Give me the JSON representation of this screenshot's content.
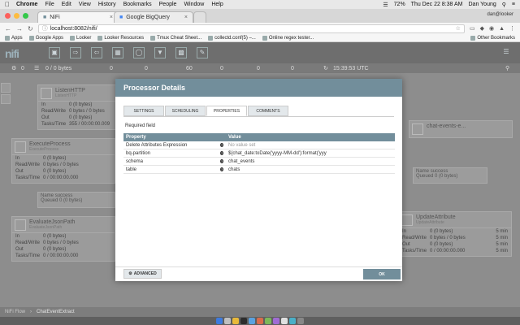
{
  "menubar": {
    "app": "Chrome",
    "items": [
      "File",
      "Edit",
      "View",
      "History",
      "Bookmarks",
      "People",
      "Window",
      "Help"
    ],
    "battery": "72%",
    "datetime": "Thu Dec 22  8:38 AM",
    "user": "Dan Young"
  },
  "browser": {
    "tabs": [
      {
        "label": "NiFi"
      },
      {
        "label": "Google BigQuery"
      }
    ],
    "profile": "dan@looker",
    "url": "localhost:8082/nifi/",
    "bookmarks": [
      "Apps",
      "Google Apps",
      "Looker",
      "Looker Resources",
      "Tmux Cheat Sheet...",
      "collectd.conf(5) –...",
      "Online regex tester..."
    ],
    "other_bookmarks": "Other Bookmarks"
  },
  "nifi": {
    "status": {
      "threads": "0",
      "queued": "0 / 0 bytes",
      "s1": "0",
      "s2": "0",
      "s3": "60",
      "s4": "0",
      "s5": "0",
      "s6": "0",
      "time": "15:39:53 UTC"
    },
    "processors": [
      {
        "name": "ListenHTTP",
        "type": "ListenHTTP",
        "in": "0 (0 bytes)",
        "rw": "0 bytes / 0 bytes",
        "out": "0 (0 bytes)",
        "tasks": "355 / 00:00:00.009"
      },
      {
        "name": "ExecuteProcess",
        "type": "ExecuteProcess",
        "in": "0 (0 bytes)",
        "rw": "0 bytes / 0 bytes",
        "out": "0 (0 bytes)",
        "tasks": "0 / 00:00:00.000"
      },
      {
        "name": "EvaluateJsonPath",
        "type": "EvaluateJsonPath",
        "in": "0 (0 bytes)",
        "rw": "0 bytes / 0 bytes",
        "out": "0 (0 bytes)",
        "tasks": "0 / 00:00:00.000"
      },
      {
        "name": "UpdateAttribute",
        "type": "UpdateAttribute",
        "in": "0 (0 bytes)",
        "rw": "0 bytes / 0 bytes",
        "out": "0 (0 bytes)",
        "tasks": "0 / 00:00:00.000"
      }
    ],
    "labels": {
      "in": "In",
      "rw": "Read/Write",
      "out": "Out",
      "tasks": "Tasks/Time",
      "name": "Name",
      "queued": "Queued",
      "mins": "5 min"
    },
    "connections": [
      {
        "name": "success",
        "queued": "0 (0 bytes)"
      },
      {
        "name": "success",
        "queued": "0 (0 bytes)"
      }
    ],
    "output_port": "chat-events-e...",
    "breadcrumb": [
      "NiFi Flow",
      "ChatEventExtract"
    ]
  },
  "modal": {
    "title": "Processor Details",
    "tabs": [
      "SETTINGS",
      "SCHEDULING",
      "PROPERTIES",
      "COMMENTS"
    ],
    "active_tab": "PROPERTIES",
    "required_field": "Required field",
    "columns": {
      "property": "Property",
      "value": "Value"
    },
    "rows": [
      {
        "property": "Delete Attributes Expression",
        "value": "No value set",
        "no_value": true
      },
      {
        "property": "bq-partition",
        "value": "${chat_date:toDate('yyyy-MM-dd'):format('yyyyM...",
        "no_value": false
      },
      {
        "property": "schema",
        "value": "chat_events",
        "no_value": false
      },
      {
        "property": "table",
        "value": "chats",
        "no_value": false
      }
    ],
    "advanced_label": "ADVANCED",
    "ok_label": "OK"
  }
}
